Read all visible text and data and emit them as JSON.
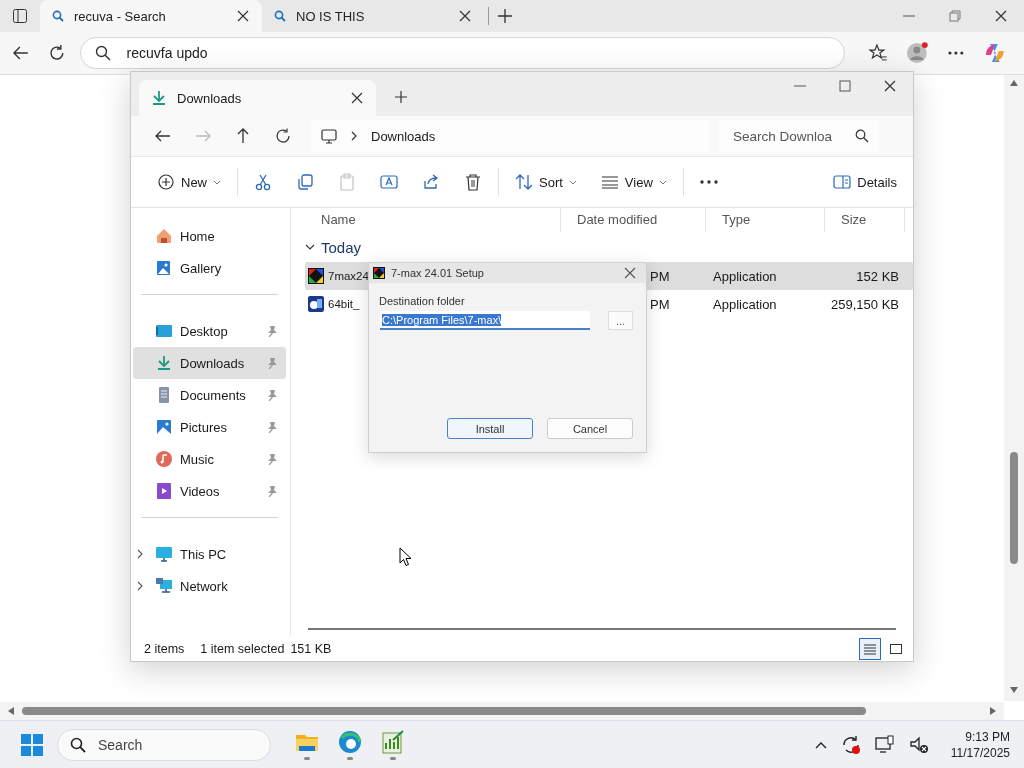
{
  "browser": {
    "tabs": [
      {
        "title": "recuva - Search",
        "selected": true
      },
      {
        "title": "NO IS THIS",
        "selected": false
      }
    ],
    "address": "recuvfa updo"
  },
  "explorer": {
    "tab_title": "Downloads",
    "breadcrumb": "Downloads",
    "search_placeholder": "Search Downloa",
    "toolbar": [
      {
        "kind": "new",
        "label": "New",
        "disabled": false
      },
      {
        "kind": "cut",
        "disabled": false
      },
      {
        "kind": "copy",
        "disabled": false
      },
      {
        "kind": "paste",
        "disabled": true
      },
      {
        "kind": "rename",
        "disabled": false
      },
      {
        "kind": "share",
        "disabled": false
      },
      {
        "kind": "delete",
        "disabled": false
      },
      {
        "kind": "sort",
        "label": "Sort",
        "disabled": false
      },
      {
        "kind": "view",
        "label": "View",
        "disabled": false
      },
      {
        "kind": "more",
        "disabled": false
      },
      {
        "kind": "details",
        "label": "Details",
        "disabled": false
      }
    ],
    "sidebar": [
      {
        "items": [
          {
            "kind": "home",
            "label": "Home",
            "pinned": false,
            "selected": false,
            "collapsed": false
          },
          {
            "kind": "gallery",
            "label": "Gallery",
            "pinned": false,
            "selected": false,
            "collapsed": false
          }
        ]
      },
      {
        "items": [
          {
            "kind": "desktop",
            "label": "Desktop",
            "pinned": true,
            "selected": false,
            "collapsed": false
          },
          {
            "kind": "downloads",
            "label": "Downloads",
            "pinned": true,
            "selected": true,
            "collapsed": false
          },
          {
            "kind": "documents",
            "label": "Documents",
            "pinned": true,
            "selected": false,
            "collapsed": false
          },
          {
            "kind": "pictures",
            "label": "Pictures",
            "pinned": true,
            "selected": false,
            "collapsed": false
          },
          {
            "kind": "music",
            "label": "Music",
            "pinned": true,
            "selected": false,
            "collapsed": false
          },
          {
            "kind": "videos",
            "label": "Videos",
            "pinned": true,
            "selected": false,
            "collapsed": false
          }
        ]
      },
      {
        "items": [
          {
            "kind": "pc",
            "label": "This PC",
            "pinned": false,
            "selected": false,
            "collapsed": true
          },
          {
            "kind": "network",
            "label": "Network",
            "pinned": false,
            "selected": false,
            "collapsed": true
          }
        ]
      }
    ],
    "columns": [
      "Name",
      "Date modified",
      "Type",
      "Size"
    ],
    "group": "Today",
    "files": [
      {
        "kind": "colorful",
        "name": "7max24",
        "date": "PM",
        "type": "Application",
        "size": "152 KB",
        "selected": true
      },
      {
        "kind": "installer",
        "name": "64bit_",
        "date": "PM",
        "type": "Application",
        "size": "259,150 KB",
        "selected": false
      }
    ],
    "status": {
      "count": "2 items",
      "selection": "1 item selected",
      "size": "151 KB"
    }
  },
  "dialog": {
    "title": "7-max 24.01 Setup",
    "label": "Destination folder",
    "value": "C:\\Program Files\\7-max\\",
    "browse": "...",
    "buttons": [
      {
        "label": "Install",
        "default": true
      },
      {
        "label": "Cancel",
        "default": false
      }
    ]
  },
  "taskbar": {
    "search_placeholder": "Search",
    "time": "9:13 PM",
    "date": "11/17/2025"
  }
}
